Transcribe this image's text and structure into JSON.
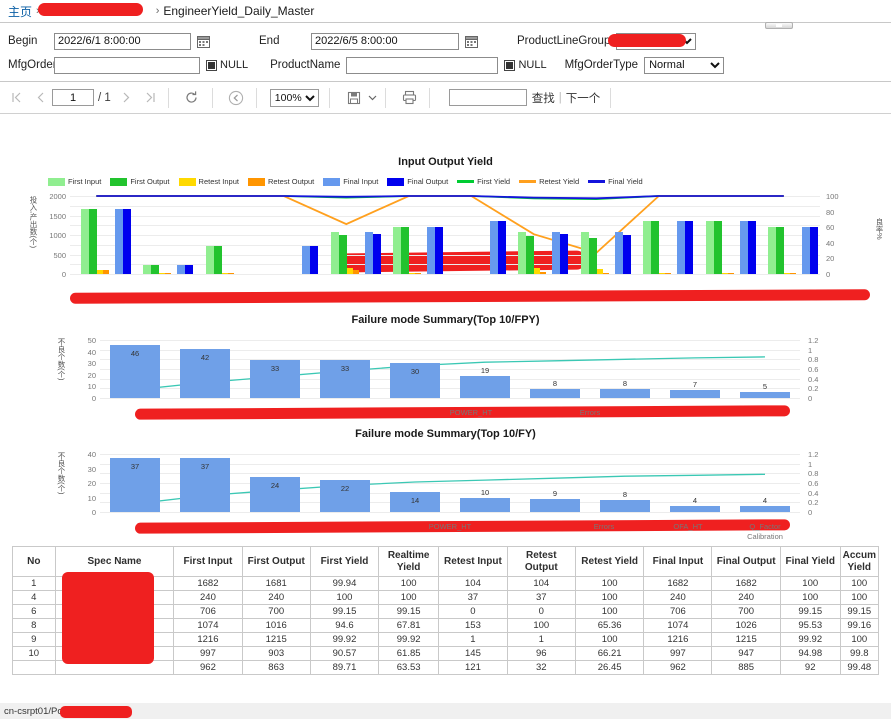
{
  "breadcrumb": {
    "home_label": "主页",
    "sep": "›",
    "redacted_folder": "",
    "current": "EngineerYield_Daily_Master"
  },
  "params": {
    "begin_label": "Begin",
    "begin_value": "2022/6/1 8:00:00",
    "end_label": "End",
    "end_value": "2022/6/5 8:00:00",
    "mfgorder_label": "MfgOrder",
    "mfgorder_value": "",
    "mfgorder_null_label": "NULL",
    "productname_label": "ProductName",
    "productname_value": "",
    "productname_null_label": "NULL",
    "productlinegroup_label": "ProductLineGroup",
    "productlinegroup_value": "",
    "mfgordertype_label": "MfgOrderType",
    "mfgordertype_value": "Normal",
    "mfgordertype_options": [
      "Normal"
    ],
    "calendar_icon": "calendar-icon"
  },
  "toolbar": {
    "first_page_icon": "first-page-icon",
    "prev_page_icon": "prev-page-icon",
    "page_value": "1",
    "page_of": "/ 1",
    "next_page_icon": "next-page-icon",
    "last_page_icon": "last-page-icon",
    "refresh_icon": "refresh-icon",
    "back_icon": "back-parent-icon",
    "zoom_value": "100%",
    "zoom_options": [
      "100%"
    ],
    "export_icon": "save-export-icon",
    "export_caret_icon": "chevron-down-icon",
    "print_icon": "print-icon",
    "find_value": "",
    "find_label": "查找",
    "find_divider": "|",
    "next_label": "下一个"
  },
  "report": {
    "title": "",
    "title_redacted": true
  },
  "chart_data": [
    {
      "type": "bar",
      "title": "Input Output Yield",
      "ylabel": "投入,产出数(个)",
      "ylabel_right": "良率%",
      "ylim": [
        0,
        2000
      ],
      "yticks": [
        0,
        500,
        1000,
        1500,
        2000
      ],
      "ylim_right": [
        0,
        100
      ],
      "yticks_right": [
        0,
        20,
        40,
        60,
        80,
        100
      ],
      "grid": true,
      "legend": [
        {
          "name": "First Input",
          "color": "#90ee90",
          "kind": "bar"
        },
        {
          "name": "First Output",
          "color": "#22c32e",
          "kind": "bar"
        },
        {
          "name": "Retest Input",
          "color": "#ffd900",
          "kind": "bar"
        },
        {
          "name": "Retest Output",
          "color": "#ff9500",
          "kind": "bar"
        },
        {
          "name": "Final Input",
          "color": "#6699ee",
          "kind": "bar"
        },
        {
          "name": "Final Output",
          "color": "#0000ee",
          "kind": "bar"
        },
        {
          "name": "First Yield",
          "color": "#00cc33",
          "kind": "line"
        },
        {
          "name": "Retest Yield",
          "color": "#ffa01e",
          "kind": "line"
        },
        {
          "name": "Final Yield",
          "color": "#1414dc",
          "kind": "line"
        }
      ],
      "categories_redacted": true,
      "categories": [
        "",
        "",
        "",
        "",
        "",
        "",
        "",
        "",
        "",
        "",
        "",
        ""
      ],
      "series": [
        {
          "name": "First Input",
          "values": [
            1670,
            240,
            710,
            0,
            1075,
            1215,
            0,
            1080,
            1090,
            1350,
            1350,
            1200
          ]
        },
        {
          "name": "First Output",
          "values": [
            1670,
            240,
            710,
            0,
            1000,
            1210,
            0,
            975,
            935,
            1350,
            1350,
            1195
          ]
        },
        {
          "name": "Retest Input",
          "values": [
            100,
            30,
            10,
            0,
            155,
            20,
            0,
            150,
            120,
            20,
            20,
            20
          ]
        },
        {
          "name": "Retest Output",
          "values": [
            100,
            25,
            5,
            0,
            105,
            15,
            0,
            55,
            35,
            15,
            15,
            15
          ]
        },
        {
          "name": "Final Input",
          "values": [
            1670,
            240,
            0,
            710,
            1080,
            1215,
            1350,
            1080,
            1090,
            1350,
            1350,
            1200
          ]
        },
        {
          "name": "Final Output",
          "values": [
            1670,
            240,
            0,
            710,
            1025,
            1215,
            1350,
            1035,
            1010,
            1350,
            1350,
            1195
          ]
        }
      ],
      "lines": [
        {
          "name": "First Yield",
          "color": "#00cc33",
          "values": [
            100,
            100,
            100,
            100,
            98,
            100,
            100,
            97,
            96,
            100,
            100,
            100
          ]
        },
        {
          "name": "Retest Yield",
          "color": "#ffa01e",
          "values": [
            100,
            100,
            100,
            100,
            64,
            100,
            100,
            51,
            27,
            100,
            100,
            100
          ]
        },
        {
          "name": "Final Yield",
          "color": "#1414dc",
          "values": [
            100,
            100,
            100,
            100,
            99,
            100,
            100,
            98,
            97,
            100,
            100,
            100
          ]
        }
      ]
    },
    {
      "type": "bar",
      "title": "Failure mode Summary(Top 10/FPY)",
      "ylabel": "不良个数(个)",
      "ylim": [
        0,
        50
      ],
      "yticks": [
        0,
        10,
        20,
        30,
        40,
        50
      ],
      "ylim_right": [
        0,
        1.2
      ],
      "yticks_right": [
        "0",
        "0.2",
        "0.4",
        "0.6",
        "0.8",
        "1",
        "1.2"
      ],
      "bar_color": "#6fa0e8",
      "line_color": "#3bc8b4",
      "values": [
        46,
        42,
        33,
        33,
        30,
        19,
        8,
        8,
        7,
        5
      ],
      "cum_line": [
        0.17,
        0.32,
        0.44,
        0.56,
        0.67,
        0.74,
        0.77,
        0.8,
        0.83,
        0.85
      ],
      "categories_redacted": true,
      "categories": [
        "",
        "",
        "",
        "POWER_HT",
        "",
        "",
        "Errors",
        "",
        "",
        ""
      ],
      "visible_xlabels": [
        {
          "text": "POWER_HT",
          "x_pct": 53
        },
        {
          "text": "Errors",
          "x_pct": 70
        }
      ]
    },
    {
      "type": "bar",
      "title": "Failure mode Summary(Top 10/FY)",
      "ylabel": "不良个数(个)",
      "ylim": [
        0,
        40
      ],
      "yticks": [
        0,
        10,
        20,
        30,
        40
      ],
      "ylim_right": [
        0,
        1.2
      ],
      "yticks_right": [
        "0",
        "0.2",
        "0.4",
        "0.6",
        "0.8",
        "1",
        "1.2"
      ],
      "bar_color": "#6fa0e8",
      "line_color": "#3bc8b4",
      "values": [
        37,
        37,
        24,
        22,
        14,
        10,
        9,
        8,
        4,
        4
      ],
      "cum_line": [
        0.17,
        0.34,
        0.45,
        0.55,
        0.62,
        0.66,
        0.7,
        0.74,
        0.76,
        0.78
      ],
      "categories_redacted": true,
      "categories": [
        "",
        "",
        "",
        "",
        "POWER_HT",
        "",
        "",
        "Errors",
        "OFA_HT",
        "Q_Factor Calibration"
      ],
      "visible_xlabels": [
        {
          "text": "POWER_HT",
          "x_pct": 50
        },
        {
          "text": "Errors",
          "x_pct": 72
        },
        {
          "text": "OFA_HT",
          "x_pct": 84
        },
        {
          "text": "Q_Factor",
          "x_pct": 95
        },
        {
          "text": "Calibration",
          "x_pct": 95
        }
      ]
    }
  ],
  "table": {
    "columns": [
      "No",
      "Spec Name",
      "First Input",
      "First Output",
      "First Yield",
      "Realtime Yield",
      "Retest Input",
      "Retest Output",
      "Retest Yield",
      "Final Input",
      "Final Output",
      "Final Yield",
      "Accum Yield"
    ],
    "spec_name_redacted": true,
    "rows": [
      {
        "no": "1",
        "spec": "",
        "first_input": "1682",
        "first_output": "1681",
        "first_yield": "99.94",
        "realtime_yield": "100",
        "retest_input": "104",
        "retest_output": "104",
        "retest_yield": "100",
        "final_input": "1682",
        "final_output": "1682",
        "final_yield": "100",
        "accum_yield": "100"
      },
      {
        "no": "4",
        "spec": "",
        "first_input": "240",
        "first_output": "240",
        "first_yield": "100",
        "realtime_yield": "100",
        "retest_input": "37",
        "retest_output": "37",
        "retest_yield": "100",
        "final_input": "240",
        "final_output": "240",
        "final_yield": "100",
        "accum_yield": "100"
      },
      {
        "no": "6",
        "spec": "",
        "first_input": "706",
        "first_output": "700",
        "first_yield": "99.15",
        "realtime_yield": "99.15",
        "retest_input": "0",
        "retest_output": "0",
        "retest_yield": "100",
        "final_input": "706",
        "final_output": "700",
        "final_yield": "99.15",
        "accum_yield": "99.15"
      },
      {
        "no": "8",
        "spec": "",
        "first_input": "1074",
        "first_output": "1016",
        "first_yield": "94.6",
        "realtime_yield": "67.81",
        "retest_input": "153",
        "retest_output": "100",
        "retest_yield": "65.36",
        "final_input": "1074",
        "final_output": "1026",
        "final_yield": "95.53",
        "accum_yield": "99.16"
      },
      {
        "no": "9",
        "spec": "",
        "first_input": "1216",
        "first_output": "1215",
        "first_yield": "99.92",
        "realtime_yield": "99.92",
        "retest_input": "1",
        "retest_output": "1",
        "retest_yield": "100",
        "final_input": "1216",
        "final_output": "1215",
        "final_yield": "99.92",
        "accum_yield": "100"
      },
      {
        "no": "10",
        "spec": "",
        "first_input": "997",
        "first_output": "903",
        "first_yield": "90.57",
        "realtime_yield": "61.85",
        "retest_input": "145",
        "retest_output": "96",
        "retest_yield": "66.21",
        "final_input": "997",
        "final_output": "947",
        "final_yield": "94.98",
        "accum_yield": "99.8"
      },
      {
        "no": "",
        "spec": "",
        "first_input": "962",
        "first_output": "863",
        "first_yield": "89.71",
        "realtime_yield": "63.53",
        "retest_input": "121",
        "retest_output": "32",
        "retest_yield": "26.45",
        "final_input": "962",
        "final_output": "885",
        "final_yield": "92",
        "accum_yield": "99.48"
      }
    ]
  },
  "statusbar": {
    "text": "cn-csrpt01/Po"
  },
  "colors": {
    "redaction": "#ef2020",
    "link": "#0b5fa5",
    "bar_blue": "#6fa0e8",
    "cum_teal": "#3bc8b4"
  }
}
